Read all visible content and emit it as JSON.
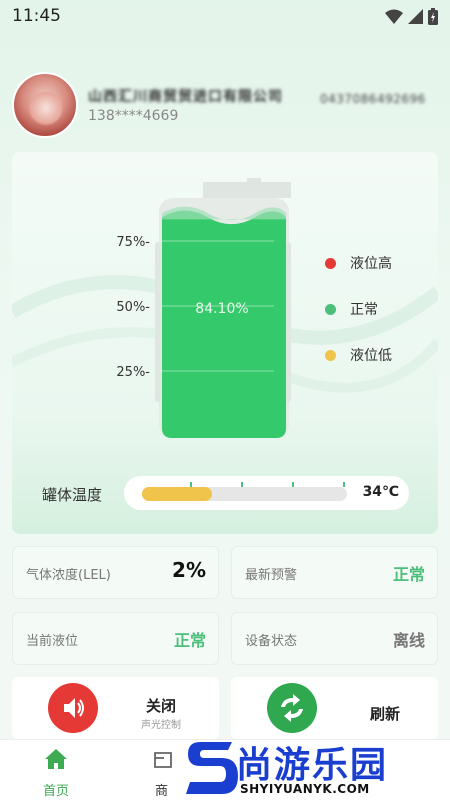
{
  "status_bar": {
    "time": "11:45"
  },
  "profile": {
    "company": "山西汇川商贸贸进口有限公司",
    "company_code": "0437086492696",
    "phone": "138****4669"
  },
  "tank": {
    "level_percent": 84.1,
    "level_text": "84.10%",
    "ticks": [
      "75%-",
      "50%-",
      "25%-"
    ],
    "legend": [
      {
        "label": "液位高",
        "color": "#e53935"
      },
      {
        "label": "正常",
        "color": "#4cbf7a"
      },
      {
        "label": "液位低",
        "color": "#f0c34a"
      }
    ],
    "fill_color": "#34c96a"
  },
  "temperature": {
    "label": "罐体温度",
    "value_text": "34℃",
    "bar_fraction": 0.34,
    "bar_color": "#f0c34a"
  },
  "info_cards": [
    {
      "label": "气体浓度(LEL)",
      "value": "2%",
      "value_color": "#111111"
    },
    {
      "label": "最新预警",
      "value": "正常",
      "value_color": "#4cbf7a"
    },
    {
      "label": "当前液位",
      "value": "正常",
      "value_color": "#4cbf7a"
    },
    {
      "label": "设备状态",
      "value": "离线",
      "value_color": "#777777"
    }
  ],
  "actions": {
    "sound": {
      "title": "关闭",
      "subtitle": "声光控制",
      "icon": "speaker-icon",
      "color": "#e53935"
    },
    "refresh": {
      "title": "刷新",
      "icon": "refresh-icon",
      "color": "#2fa84f"
    }
  },
  "tabbar": {
    "items": [
      {
        "label": "首页",
        "icon": "home-icon",
        "active": true
      },
      {
        "label": "商",
        "icon": "shop-icon",
        "active": false
      }
    ]
  },
  "watermark": {
    "text": "尚游乐园",
    "sub": "SHYIYUANYK.COM"
  }
}
